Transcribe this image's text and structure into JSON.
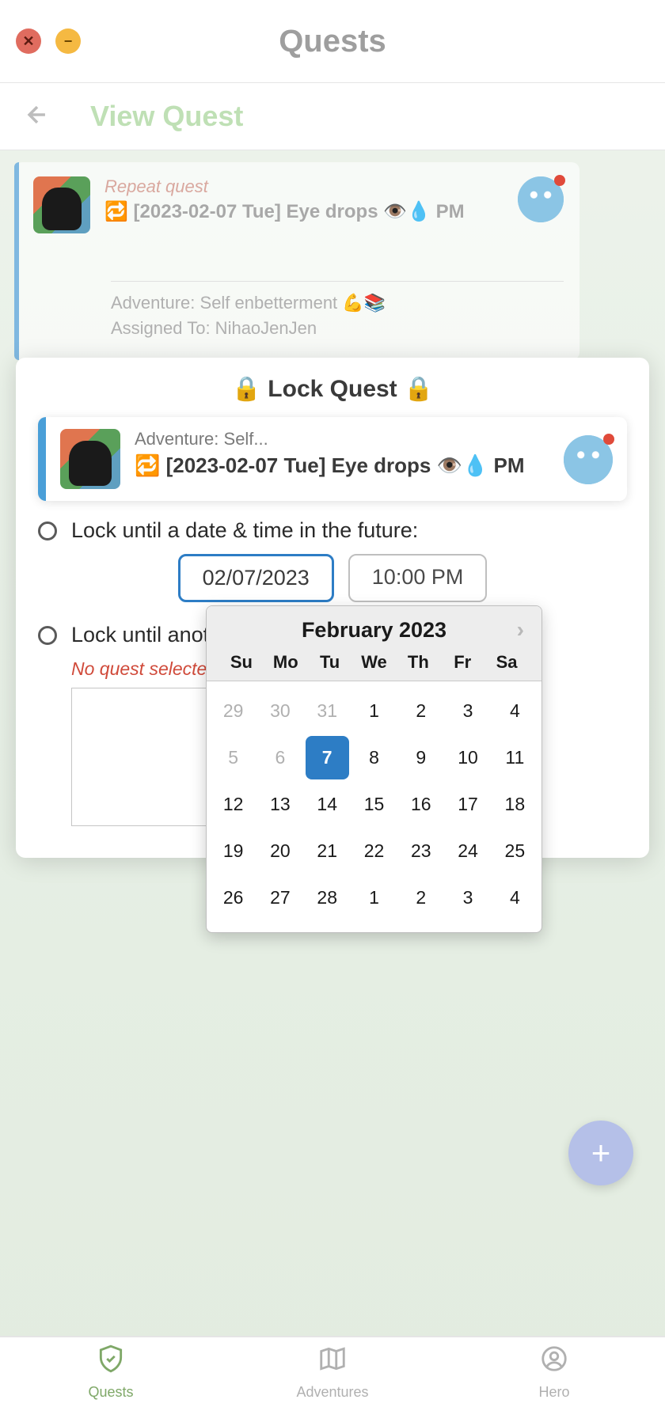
{
  "app_title": "Quests",
  "subheader": {
    "title": "View Quest"
  },
  "quest": {
    "repeat_label": "Repeat quest",
    "title": "🔁 [2023-02-07 Tue] Eye drops 👁️💧 PM",
    "adventure": "Adventure: Self enbetterment 💪📚",
    "assigned": "Assigned To: NihaoJenJen"
  },
  "modal": {
    "title": "🔒 Lock Quest 🔒",
    "quest_adventure": "Adventure: Self...",
    "quest_title": "🔁 [2023-02-07 Tue] Eye drops 👁️💧 PM",
    "option_date": "Lock until a date & time in the future:",
    "date_value": "02/07/2023",
    "time_value": "10:00 PM",
    "option_quest": "Lock until anot",
    "no_quest": "No quest selected."
  },
  "datepicker": {
    "month": "February 2023",
    "weekdays": [
      "Su",
      "Mo",
      "Tu",
      "We",
      "Th",
      "Fr",
      "Sa"
    ],
    "cells": [
      {
        "d": "29",
        "other": true
      },
      {
        "d": "30",
        "other": true
      },
      {
        "d": "31",
        "other": true
      },
      {
        "d": "1"
      },
      {
        "d": "2"
      },
      {
        "d": "3"
      },
      {
        "d": "4"
      },
      {
        "d": "5",
        "other": true
      },
      {
        "d": "6",
        "other": true
      },
      {
        "d": "7",
        "selected": true
      },
      {
        "d": "8"
      },
      {
        "d": "9"
      },
      {
        "d": "10"
      },
      {
        "d": "11"
      },
      {
        "d": "12"
      },
      {
        "d": "13"
      },
      {
        "d": "14"
      },
      {
        "d": "15"
      },
      {
        "d": "16"
      },
      {
        "d": "17"
      },
      {
        "d": "18"
      },
      {
        "d": "19"
      },
      {
        "d": "20"
      },
      {
        "d": "21"
      },
      {
        "d": "22"
      },
      {
        "d": "23"
      },
      {
        "d": "24"
      },
      {
        "d": "25"
      },
      {
        "d": "26"
      },
      {
        "d": "27"
      },
      {
        "d": "28"
      },
      {
        "d": "1",
        "other": false
      },
      {
        "d": "2",
        "other": false
      },
      {
        "d": "3",
        "other": false
      },
      {
        "d": "4",
        "other": false
      }
    ]
  },
  "bottom_nav": {
    "quests": "Quests",
    "adventures": "Adventures",
    "hero": "Hero"
  }
}
